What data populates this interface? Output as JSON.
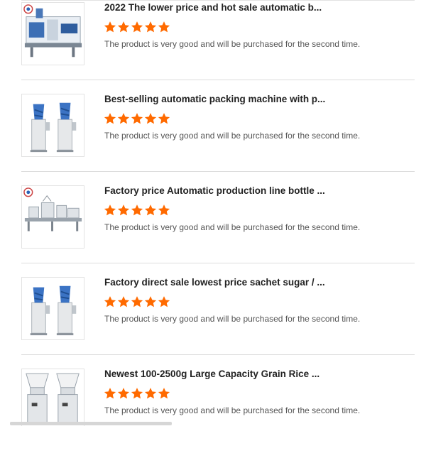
{
  "reviews": [
    {
      "title": "2022 The lower price and hot sale automatic b...",
      "rating": 5,
      "comment": "The product is very good and will be purchased for the second time.",
      "image_icon": "labeling-machine-icon"
    },
    {
      "title": "Best-selling automatic packing machine with p...",
      "rating": 5,
      "comment": "The product is very good and will be purchased for the second time.",
      "image_icon": "packing-machine-icon"
    },
    {
      "title": "Factory price Automatic production line bottle ...",
      "rating": 5,
      "comment": "The product is very good and will be purchased for the second time.",
      "image_icon": "production-line-icon"
    },
    {
      "title": "Factory direct sale lowest price sachet sugar / ...",
      "rating": 5,
      "comment": "The product is very good and will be purchased for the second time.",
      "image_icon": "packing-machine-icon"
    },
    {
      "title": "Newest 100-2500g Large Capacity Grain Rice ...",
      "rating": 5,
      "comment": "The product is very good and will be purchased for the second time.",
      "image_icon": "grain-filler-icon"
    }
  ],
  "colors": {
    "star": "#ff6a00",
    "title": "#222222",
    "comment": "#555555",
    "divider": "#dcdcdc"
  }
}
